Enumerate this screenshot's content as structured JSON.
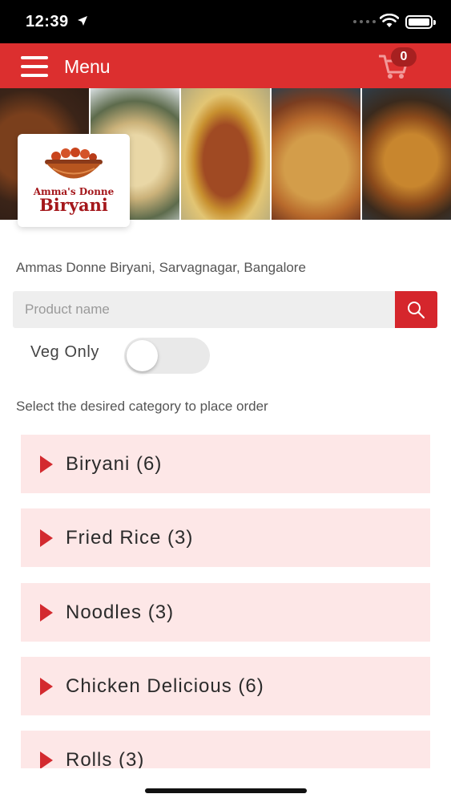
{
  "status_bar": {
    "time": "12:39"
  },
  "header": {
    "menu_label": "Menu",
    "cart_count": "0"
  },
  "logo": {
    "line1": "Amma's Donne",
    "line2": "Biryani"
  },
  "restaurant": {
    "address": "Ammas Donne Biryani, Sarvagnagar, Bangalore"
  },
  "search": {
    "placeholder": "Product name"
  },
  "filter": {
    "veg_only_label": "Veg Only",
    "veg_only_on": false
  },
  "category_hint": "Select the desired category to place order",
  "categories": [
    {
      "label": "Biryani (6)"
    },
    {
      "label": "Fried Rice (3)"
    },
    {
      "label": "Noodles (3)"
    },
    {
      "label": "Chicken Delicious (6)"
    },
    {
      "label": "Rolls (3)"
    }
  ],
  "colors": {
    "brand_red": "#dc2f2f",
    "category_bg": "#fde7e7",
    "accent_red": "#d32a2f"
  }
}
